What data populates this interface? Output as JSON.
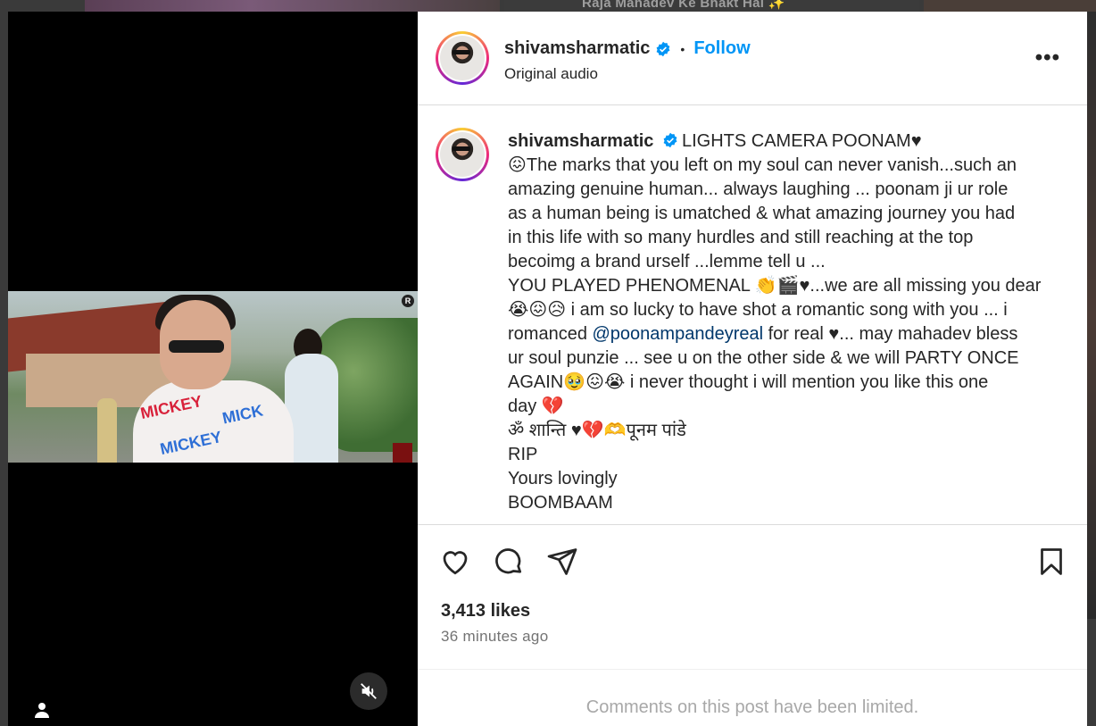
{
  "background": {
    "banner_text": "Raja Mahadev Ke Bhakt Hai ✨"
  },
  "post": {
    "author": {
      "username": "shivamsharmatic",
      "verified": true,
      "follow_label": "Follow",
      "separator": "•",
      "audio_label": "Original audio"
    },
    "more_icon": "more-options-icon",
    "caption": {
      "username": "shivamsharmatic",
      "lines": [
        "LIGHTS CAMERA POONAM♥",
        "😖The marks that you left on my soul can never vanish...such an",
        "amazing genuine human... always laughing ... poonam ji ur role",
        "as a human being is umatched & what amazing journey you had",
        "in this life with so many hurdles and still reaching at the top",
        "becoimg a brand urself ...lemme tell u ...",
        "YOU PLAYED PHENOMENAL 👏🎬♥...we are all missing you dear",
        "😭😖😥 i am so lucky to have shot a romantic song with you ... i",
        "romanced",
        "@poonampandeyreal",
        "for real ♥... may mahadev bless",
        "ur soul punzie ... see u on the other side & we will PARTY ONCE",
        "AGAIN🥹😖😭 i never thought i will mention you like this one",
        "day 💔",
        "ॐ शान्ति ♥💔🫶पूनम पांडे",
        "RIP",
        "Yours lovingly",
        "BOOMBAAM"
      ]
    },
    "video": {
      "watermark": "R"
    },
    "likes": "3,413 likes",
    "time_ago": "36 minutes ago",
    "comments_limited": "Comments on this post have been limited.",
    "colors": {
      "accent": "#0095f6",
      "mention": "#00376b",
      "text": "#262626",
      "muted": "#737373"
    }
  }
}
